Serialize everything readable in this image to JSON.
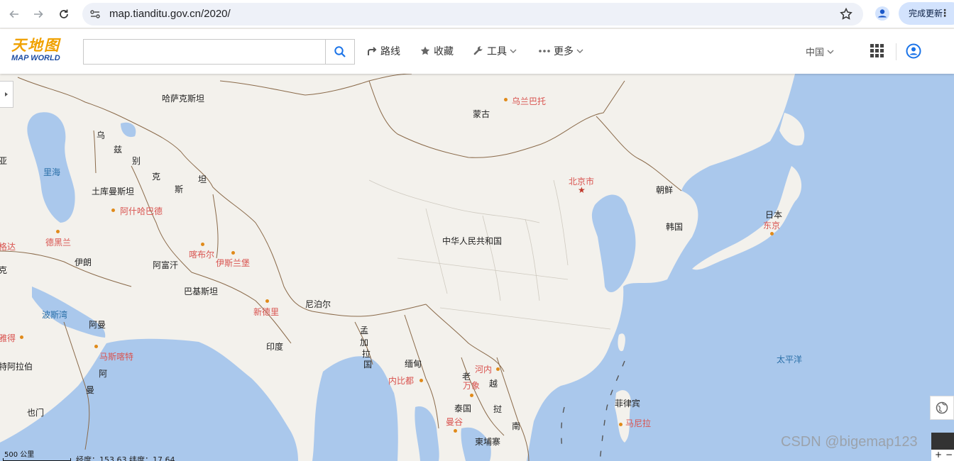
{
  "browser": {
    "url": "map.tianditu.gov.cn/2020/",
    "update_button": "完成更新",
    "menu_dots": "⋮"
  },
  "app": {
    "logo_top": "天地图",
    "logo_bottom": "MAP WORLD",
    "search": {
      "value": "",
      "placeholder": ""
    },
    "tools": [
      {
        "label": "路线",
        "icon": "route-icon"
      },
      {
        "label": "收藏",
        "icon": "star-icon"
      },
      {
        "label": "工具",
        "icon": "wrench-icon"
      },
      {
        "label": "更多",
        "icon": "more-dots-icon"
      }
    ],
    "region": "中国"
  },
  "map": {
    "labels": [
      {
        "text": "哈萨克斯坦",
        "kind": "country"
      },
      {
        "text": "蒙古",
        "kind": "country"
      },
      {
        "text": "乌兰巴托",
        "kind": "city"
      },
      {
        "text": "乌",
        "kind": "country"
      },
      {
        "text": "兹",
        "kind": "country"
      },
      {
        "text": "别",
        "kind": "country"
      },
      {
        "text": "克",
        "kind": "country"
      },
      {
        "text": "斯",
        "kind": "country"
      },
      {
        "text": "坦",
        "kind": "country"
      },
      {
        "text": "里海",
        "kind": "water"
      },
      {
        "text": "土库曼斯坦",
        "kind": "country"
      },
      {
        "text": "阿什哈巴德",
        "kind": "city"
      },
      {
        "text": "北京市",
        "kind": "city"
      },
      {
        "text": "朝鲜",
        "kind": "country"
      },
      {
        "text": "韩国",
        "kind": "country"
      },
      {
        "text": "日本",
        "kind": "country"
      },
      {
        "text": "东京",
        "kind": "city"
      },
      {
        "text": "德黑兰",
        "kind": "city"
      },
      {
        "text": "喀布尔",
        "kind": "city"
      },
      {
        "text": "伊斯兰堡",
        "kind": "city"
      },
      {
        "text": "伊朗",
        "kind": "country"
      },
      {
        "text": "阿富汗",
        "kind": "country"
      },
      {
        "text": "中华人民共和国",
        "kind": "country"
      },
      {
        "text": "巴基斯坦",
        "kind": "country"
      },
      {
        "text": "新德里",
        "kind": "city"
      },
      {
        "text": "尼泊尔",
        "kind": "country"
      },
      {
        "text": "波斯湾",
        "kind": "water"
      },
      {
        "text": "阿曼",
        "kind": "country"
      },
      {
        "text": "孟",
        "kind": "country"
      },
      {
        "text": "加",
        "kind": "country"
      },
      {
        "text": "拉",
        "kind": "country"
      },
      {
        "text": "国",
        "kind": "country"
      },
      {
        "text": "印度",
        "kind": "country"
      },
      {
        "text": "马斯喀特",
        "kind": "city"
      },
      {
        "text": "缅甸",
        "kind": "country"
      },
      {
        "text": "河内",
        "kind": "city"
      },
      {
        "text": "老",
        "kind": "country"
      },
      {
        "text": "越",
        "kind": "country"
      },
      {
        "text": "万象",
        "kind": "city"
      },
      {
        "text": "内比都",
        "kind": "city"
      },
      {
        "text": "太平洋",
        "kind": "water"
      },
      {
        "text": "阿",
        "kind": "country"
      },
      {
        "text": "曼",
        "kind": "country"
      },
      {
        "text": "泰国",
        "kind": "country"
      },
      {
        "text": "挝",
        "kind": "country"
      },
      {
        "text": "菲律宾",
        "kind": "country"
      },
      {
        "text": "也门",
        "kind": "country"
      },
      {
        "text": "曼谷",
        "kind": "city"
      },
      {
        "text": "南",
        "kind": "country"
      },
      {
        "text": "马尼拉",
        "kind": "city"
      },
      {
        "text": "柬埔寨",
        "kind": "country"
      },
      {
        "text": "特阿拉伯",
        "kind": "country"
      },
      {
        "text": "雅得",
        "kind": "city"
      },
      {
        "text": "格达",
        "kind": "city"
      },
      {
        "text": "克",
        "kind": "country"
      },
      {
        "text": "亚",
        "kind": "country"
      }
    ],
    "scale_label": "500 公里",
    "coordinates": "经度：153.63  纬度：17.64",
    "zoom_in": "+",
    "zoom_out": "−",
    "watermark": "CSDN @bigemap123"
  },
  "colors": {
    "water": "#aac8ec",
    "land": "#f3f1ec",
    "border": "#8a6a4a",
    "accent": "#1a73e8",
    "city_label": "#d9534f"
  }
}
